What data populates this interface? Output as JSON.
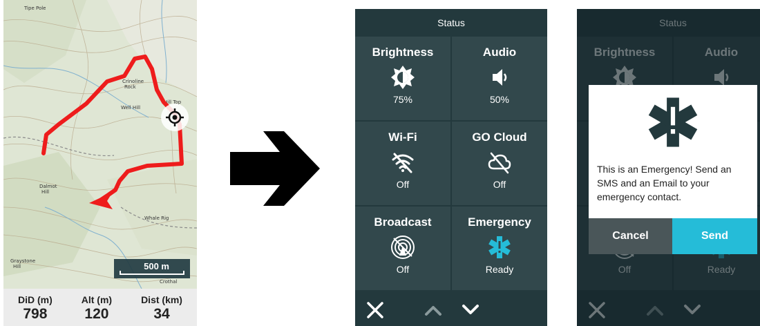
{
  "map_screen": {
    "scale_label": "500 m",
    "stats": [
      {
        "label": "DiD (m)",
        "value": "798"
      },
      {
        "label": "Alt (m)",
        "value": "120"
      },
      {
        "label": "Dist (km)",
        "value": "34"
      }
    ],
    "place_labels": [
      "Tipe Pole",
      "Crinoline Rock",
      "Well Hill",
      "Dalmot Hill",
      "Whale Rig",
      "Graystone Hill",
      "Crothal",
      "Hill Top"
    ],
    "route_color": "#ee1c1c"
  },
  "status_screen": {
    "title": "Status",
    "tiles": [
      {
        "title": "Brightness",
        "icon": "brightness-icon",
        "value": "75%"
      },
      {
        "title": "Audio",
        "icon": "speaker-icon",
        "value": "50%"
      },
      {
        "title": "Wi-Fi",
        "icon": "wifi-off-icon",
        "value": "Off"
      },
      {
        "title": "GO Cloud",
        "icon": "cloud-off-icon",
        "value": "Off"
      },
      {
        "title": "Broadcast",
        "icon": "broadcast-off-icon",
        "value": "Off"
      },
      {
        "title": "Emergency",
        "icon": "emergency-icon",
        "value": "Ready"
      }
    ],
    "nav": [
      "close-icon",
      "chevron-up-icon",
      "chevron-down-icon"
    ],
    "accent_color": "#25bcd8"
  },
  "emergency_dialog": {
    "message": "This is an Emergency! Send an SMS and an Email to your emergency contact.",
    "cancel_label": "Cancel",
    "send_label": "Send"
  }
}
